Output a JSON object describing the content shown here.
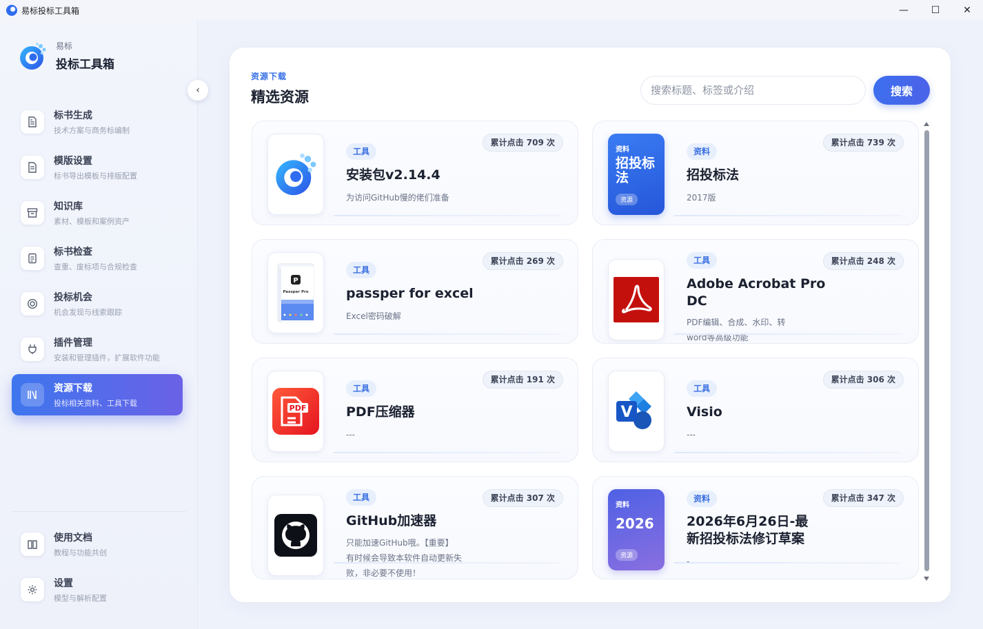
{
  "window": {
    "title": "易标投标工具箱",
    "controls": {
      "minimize": "—",
      "maximize": "☐",
      "close": "✕"
    }
  },
  "brand": {
    "sub": "易标",
    "main": "投标工具箱"
  },
  "sidebar": {
    "collapse_icon": "‹",
    "items": [
      {
        "title": "标书生成",
        "desc": "技术方案与商务标编制",
        "icon": "file-generate-icon"
      },
      {
        "title": "模版设置",
        "desc": "标书导出模板与排版配置",
        "icon": "template-icon"
      },
      {
        "title": "知识库",
        "desc": "素材、模板和案例资产",
        "icon": "archive-icon"
      },
      {
        "title": "标书检查",
        "desc": "查重、废标项与合规检查",
        "icon": "checklist-icon"
      },
      {
        "title": "投标机会",
        "desc": "机会发现与线索跟踪",
        "icon": "target-icon"
      },
      {
        "title": "插件管理",
        "desc": "安装和管理插件，扩展软件功能",
        "icon": "plug-icon"
      },
      {
        "title": "资源下载",
        "desc": "投标相关资料、工具下载",
        "icon": "library-icon",
        "active": true
      }
    ],
    "bottom_items": [
      {
        "title": "使用文档",
        "desc": "教程与功能共创",
        "icon": "book-icon"
      },
      {
        "title": "设置",
        "desc": "模型与解析配置",
        "icon": "gear-icon"
      }
    ]
  },
  "main": {
    "breadcrumb": "资源下载",
    "title": "精选资源",
    "search": {
      "placeholder": "搜索标题、标签或介绍",
      "button": "搜索"
    },
    "cards": [
      {
        "tag": "工具",
        "title": "安装包v2.14.4",
        "desc": [
          "为访问GitHub慢的佬们准备"
        ],
        "clicks": "累计点击 709 次",
        "thumb": "app-logo-icon"
      },
      {
        "tag": "资料",
        "title": "招投标法",
        "desc": [
          "2017版"
        ],
        "clicks": "累计点击 739 次",
        "thumb": "cover",
        "cover": {
          "tag": "资料",
          "title": "招投标法",
          "badge": "资源"
        }
      },
      {
        "tag": "工具",
        "title": "passper for excel",
        "desc": [
          "Excel密码破解"
        ],
        "clicks": "累计点击 269 次",
        "thumb": "passper-box-icon",
        "box_label": "Passper Pro"
      },
      {
        "tag": "工具",
        "title": "Adobe Acrobat Pro DC",
        "desc": [
          "PDF编辑、合成、水印、转",
          "word等高级功能"
        ],
        "clicks": "累计点击 248 次",
        "thumb": "acrobat-icon"
      },
      {
        "tag": "工具",
        "title": "PDF压缩器",
        "desc": [
          "---"
        ],
        "clicks": "累计点击 191 次",
        "thumb": "pdf-compressor-icon",
        "icon_text": "PDF"
      },
      {
        "tag": "工具",
        "title": "Visio",
        "desc": [
          "---"
        ],
        "clicks": "累计点击 306 次",
        "thumb": "visio-icon",
        "icon_text": "V"
      },
      {
        "tag": "工具",
        "title": "GitHub加速器",
        "desc": [
          "只能加速GitHub哦。【重要】",
          "有时候会导致本软件自动更新失",
          "败，非必要不使用！"
        ],
        "clicks": "累计点击 307 次",
        "thumb": "github-icon"
      },
      {
        "tag": "资料",
        "title": "2026年6月26日-最新招投标法修订草案",
        "title_lines": [
          "2026年6月26日-最",
          "新招投标法修订草案"
        ],
        "desc": [
          "-"
        ],
        "clicks": "累计点击 347 次",
        "thumb": "cover",
        "cover": {
          "tag": "资料",
          "title": "2026",
          "badge": "资源"
        }
      }
    ]
  },
  "colors": {
    "accent": "#3e76ee",
    "active_gradient_end": "#6a61e6",
    "tag_bg": "#e7effd",
    "tag_text": "#3a6fe0",
    "cover_blue": "#2a66e8",
    "cover_purple": "#6d5fd8"
  }
}
